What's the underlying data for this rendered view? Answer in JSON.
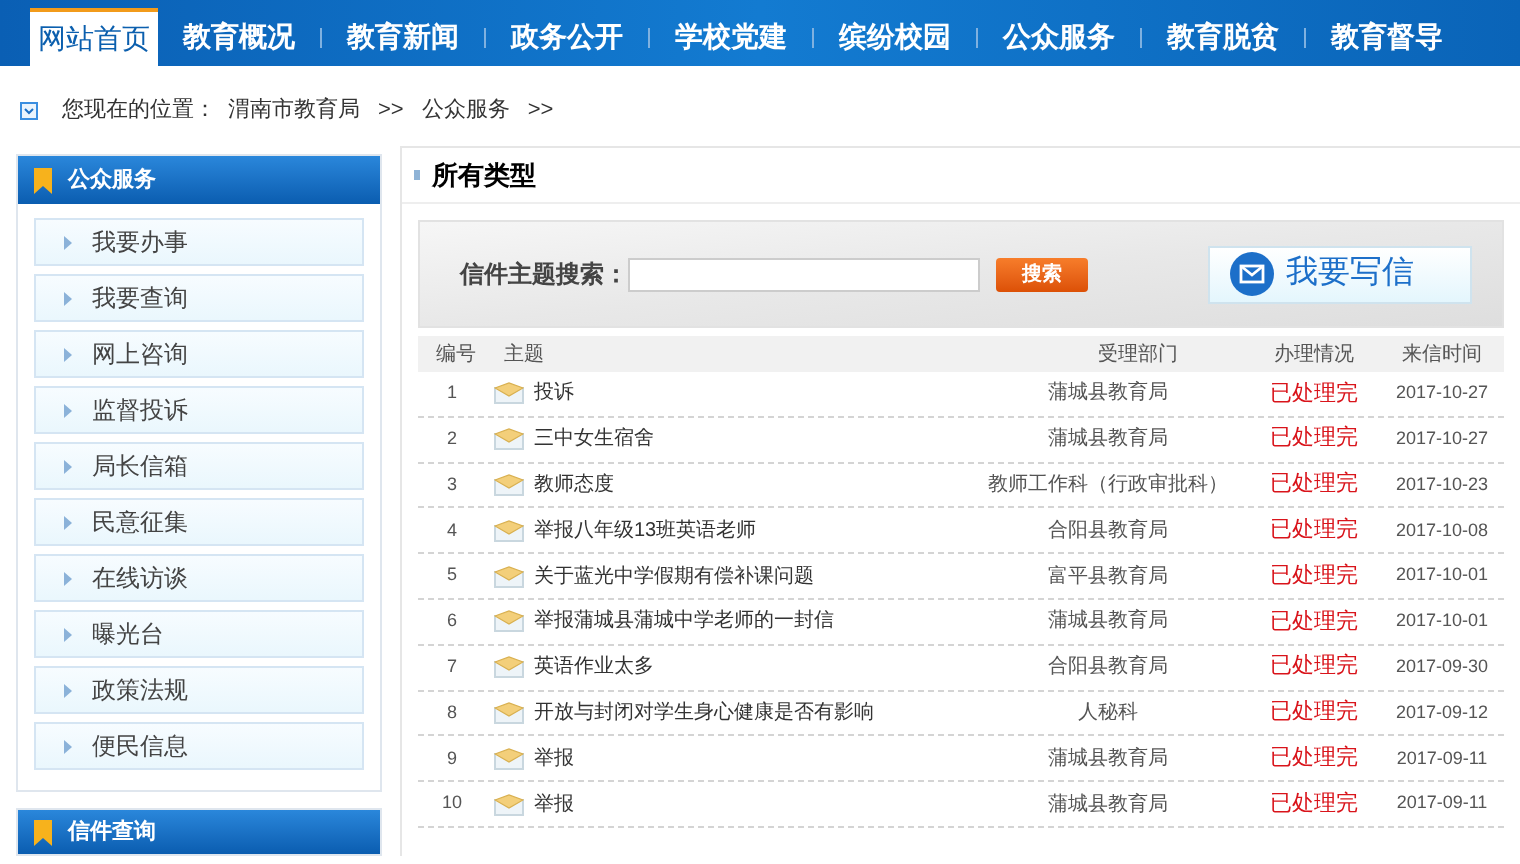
{
  "nav": [
    {
      "label": "网站首页",
      "selected": true
    },
    {
      "label": "教育概况",
      "selected": false
    },
    {
      "label": "教育新闻",
      "selected": false
    },
    {
      "label": "政务公开",
      "selected": false
    },
    {
      "label": "学校党建",
      "selected": false
    },
    {
      "label": "缤纷校园",
      "selected": false
    },
    {
      "label": "公众服务",
      "selected": false
    },
    {
      "label": "教育脱贫",
      "selected": false
    },
    {
      "label": "教育督导",
      "selected": false
    }
  ],
  "breadcrumb": {
    "label": "您现在的位置：",
    "items": [
      "渭南市教育局",
      "公众服务"
    ],
    "separator": ">>"
  },
  "sidebar": {
    "title": "公众服务",
    "items": [
      "我要办事",
      "我要查询",
      "网上咨询",
      "监督投诉",
      "局长信箱",
      "民意征集",
      "在线访谈",
      "曝光台",
      "政策法规",
      "便民信息"
    ],
    "next_title": "信件查询"
  },
  "main": {
    "title": "所有类型",
    "search": {
      "label": "信件主题搜索：",
      "button": "搜索"
    },
    "write_button": "我要写信",
    "table": {
      "columns": [
        "编号",
        "主题",
        "受理部门",
        "办理情况",
        "来信时间"
      ],
      "rows": [
        [
          "1",
          "投诉",
          "蒲城县教育局",
          "已处理完",
          "2017-10-27"
        ],
        [
          "2",
          "三中女生宿舍",
          "蒲城县教育局",
          "已处理完",
          "2017-10-27"
        ],
        [
          "3",
          "教师态度",
          "教师工作科（行政审批科）",
          "已处理完",
          "2017-10-23"
        ],
        [
          "4",
          "举报八年级13班英语老师",
          "合阳县教育局",
          "已处理完",
          "2017-10-08"
        ],
        [
          "5",
          "关于蓝光中学假期有偿补课问题",
          "富平县教育局",
          "已处理完",
          "2017-10-01"
        ],
        [
          "6",
          "举报蒲城县蒲城中学老师的一封信",
          "蒲城县教育局",
          "已处理完",
          "2017-10-01"
        ],
        [
          "7",
          "英语作业太多",
          "合阳县教育局",
          "已处理完",
          "2017-09-30"
        ],
        [
          "8",
          "开放与封闭对学生身心健康是否有影响",
          "人秘科",
          "已处理完",
          "2017-09-12"
        ],
        [
          "9",
          "举报",
          "蒲城县教育局",
          "已处理完",
          "2017-09-11"
        ],
        [
          "10",
          "举报",
          "蒲城县教育局",
          "已处理完",
          "2017-09-11"
        ]
      ]
    }
  }
}
